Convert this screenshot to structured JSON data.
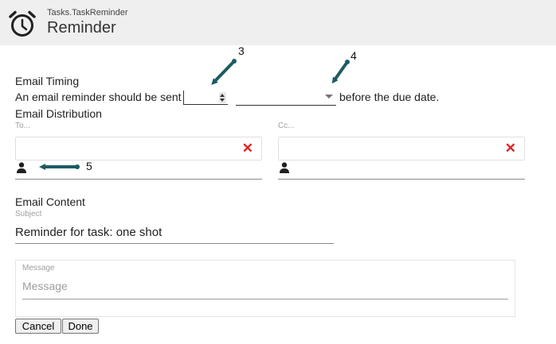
{
  "header": {
    "subtitle": "Tasks.TaskReminder",
    "title": "Reminder",
    "icon": "alarm-clock-icon"
  },
  "email_timing": {
    "section_label": "Email Timing",
    "sentence_prefix": "An email reminder should be sent",
    "number_value": "",
    "unit_value": "",
    "sentence_suffix": "before the due date."
  },
  "email_distribution": {
    "section_label": "Email Distribution",
    "to_label": "To...",
    "cc_label": "Cc...",
    "to_value": "",
    "cc_value": "",
    "clear_icon": "close-icon",
    "person_icon": "person-icon"
  },
  "email_content": {
    "section_label": "Email Content",
    "subject_label": "Subject",
    "subject_value": "Reminder for task: one shot",
    "message_label": "Message",
    "message_placeholder": "Message"
  },
  "buttons": {
    "cancel": "Cancel",
    "done": "Done"
  },
  "annotations": {
    "callout_3": "3",
    "callout_4": "4",
    "callout_5": "5",
    "arrow_color": "#1d5b63"
  }
}
